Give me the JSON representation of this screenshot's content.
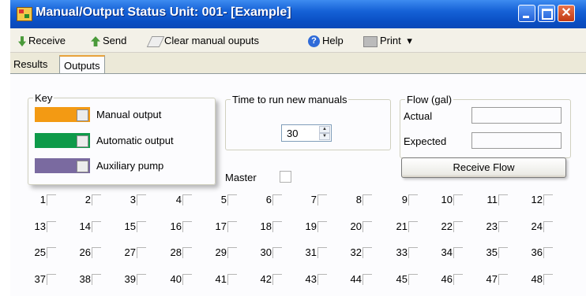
{
  "window": {
    "title": "Manual/Output Status Unit: 001- [Example]",
    "close_glyph": "✕"
  },
  "toolbar": {
    "receive": "Receive",
    "send": "Send",
    "clear": "Clear manual ouputs",
    "help": "Help",
    "help_glyph": "?",
    "print": "Print",
    "print_arrow": "▾",
    "icons": {
      "receive": "arrow-down-icon",
      "send": "arrow-up-icon",
      "clear": "eraser-icon",
      "help": "help-icon",
      "print": "printer-icon"
    }
  },
  "tabs": [
    {
      "label": "Results",
      "active": false
    },
    {
      "label": "Outputs",
      "active": true
    }
  ],
  "key": {
    "title": "Key",
    "items": [
      {
        "label": "Manual output",
        "color": "#f39a13"
      },
      {
        "label": "Automatic output",
        "color": "#0e9a4a"
      },
      {
        "label": "Auxiliary pump",
        "color": "#7a6aa0"
      }
    ]
  },
  "time": {
    "label": "Time to run new manuals",
    "value": "30",
    "up_glyph": "▲",
    "down_glyph": "▼"
  },
  "flow": {
    "title": "Flow (gal)",
    "actual_label": "Actual",
    "actual_value": "",
    "expected_label": "Expected",
    "expected_value": "",
    "button": "Receive Flow"
  },
  "master": {
    "label": "Master",
    "checked": false
  },
  "outputs": [
    [
      "1",
      "2",
      "3",
      "4",
      "5",
      "6",
      "7",
      "8",
      "9",
      "10",
      "11",
      "12"
    ],
    [
      "13",
      "14",
      "15",
      "16",
      "17",
      "18",
      "19",
      "20",
      "21",
      "22",
      "23",
      "24"
    ],
    [
      "25",
      "26",
      "27",
      "28",
      "29",
      "30",
      "31",
      "32",
      "33",
      "34",
      "35",
      "36"
    ],
    [
      "37",
      "38",
      "39",
      "40",
      "41",
      "42",
      "43",
      "44",
      "45",
      "46",
      "47",
      "48"
    ]
  ]
}
